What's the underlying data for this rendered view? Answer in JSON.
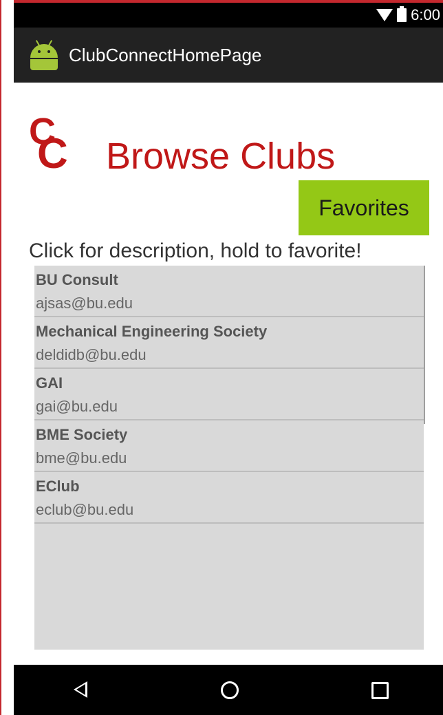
{
  "status_bar": {
    "time": "6:00",
    "wifi_icon": "wifi-icon",
    "battery_icon": "battery-icon"
  },
  "action_bar": {
    "title": "ClubConnectHomePage",
    "icon": "android-icon"
  },
  "header": {
    "logo_text_1": "C",
    "logo_text_2": "C",
    "title": "Browse Clubs"
  },
  "favorites_button": {
    "label": "Favorites"
  },
  "instruction": "Click for description, hold to favorite!",
  "clubs": [
    {
      "name": "BU Consult",
      "email": "ajsas@bu.edu"
    },
    {
      "name": "Mechanical Engineering Society",
      "email": "deldidb@bu.edu"
    },
    {
      "name": "GAI",
      "email": "gai@bu.edu"
    },
    {
      "name": "BME Society",
      "email": "bme@bu.edu"
    },
    {
      "name": "EClub",
      "email": "eclub@bu.edu"
    }
  ],
  "nav_bar": {
    "back_icon": "back-icon",
    "home_icon": "home-icon",
    "recents_icon": "recents-icon"
  },
  "colors": {
    "accent_red": "#c01818",
    "favorites_green": "#94c816",
    "list_bg": "#d9d9d9"
  }
}
